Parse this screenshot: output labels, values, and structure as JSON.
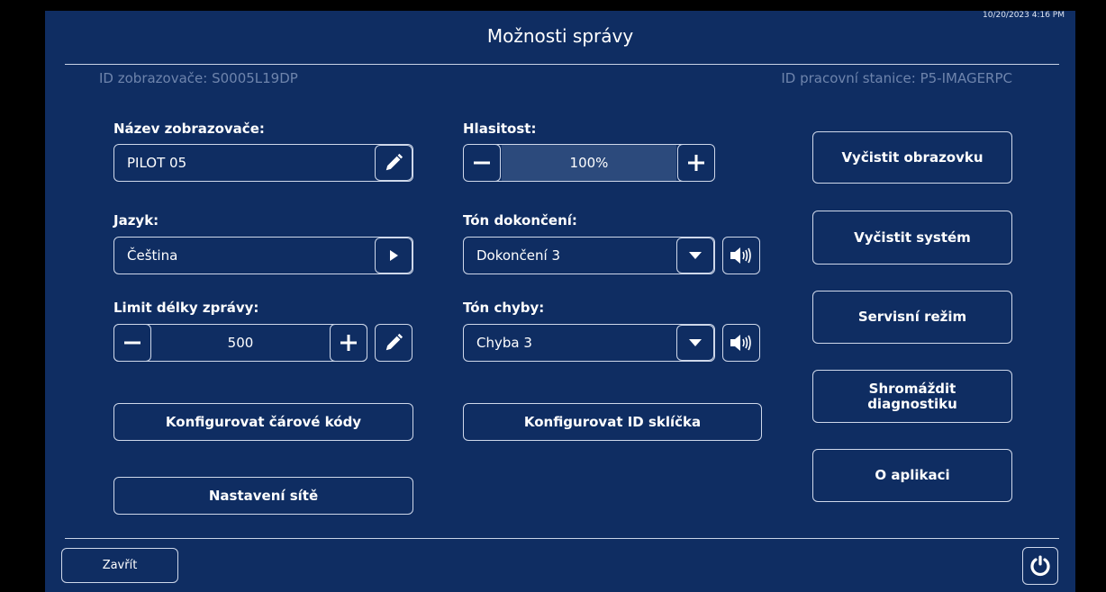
{
  "timestamp": "10/20/2023 4:16 PM",
  "title": "Možnosti správy",
  "viewer_id": "ID zobrazovače: S0005L19DP",
  "workstation_id": "ID pracovní stanice: P5-IMAGERPC",
  "viewer_name": {
    "label": "Název zobrazovače:",
    "value": "PILOT 05"
  },
  "language": {
    "label": "Jazyk:",
    "value": "Čeština"
  },
  "message_limit": {
    "label": "Limit délky zprávy:",
    "value": "500"
  },
  "volume": {
    "label": "Hlasitost:",
    "value": "100%"
  },
  "completion_tone": {
    "label": "Tón dokončení:",
    "value": "Dokončení 3"
  },
  "error_tone": {
    "label": "Tón chyby:",
    "value": "Chyba 3"
  },
  "buttons": {
    "configure_barcodes": "Konfigurovat čárové kódy",
    "configure_slide_id": "Konfigurovat ID sklíčka",
    "network_settings": "Nastavení sítě",
    "clear_screen": "Vyčistit obrazovku",
    "clear_system": "Vyčistit systém",
    "service_mode": "Servisní režim",
    "collect_diagnostics": "Shromáždit diagnostiku",
    "about": "O aplikaci",
    "close": "Zavřít"
  },
  "icons": [
    "pencil-icon",
    "play-icon",
    "minus-icon",
    "plus-icon",
    "dropdown-arrow-icon",
    "speaker-icon",
    "power-icon"
  ],
  "colors": {
    "background": "#0f2d62",
    "border": "#cfd8ea",
    "muted_text": "#6e84ac",
    "volume_fill": "#2c4a7c"
  }
}
